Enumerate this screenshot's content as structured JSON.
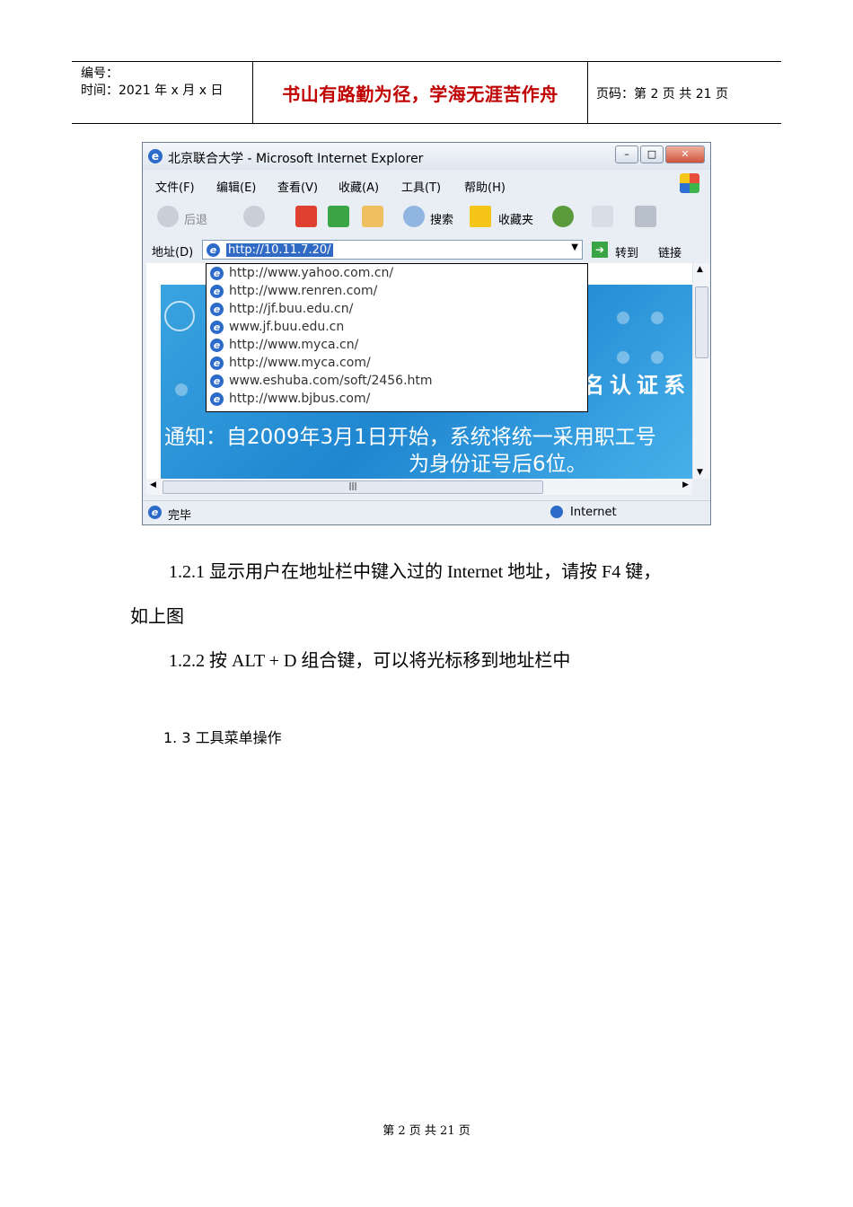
{
  "header": {
    "number_label": "编号：",
    "date_label": "时间：2021 年 x 月 x 日",
    "motto": "书山有路勤为径，学海无涯苦作舟",
    "page_info": "页码：第 2 页  共 21 页"
  },
  "screenshot": {
    "title": "北京联合大学 - Microsoft Internet Explorer",
    "menu": [
      "文件(F)",
      "编辑(E)",
      "查看(V)",
      "收藏(A)",
      "工具(T)",
      "帮助(H)"
    ],
    "toolbar": {
      "back": "后退",
      "search": "搜索",
      "favorites": "收藏夹"
    },
    "address_label": "地址(D)",
    "address_value": "http://10.11.7.20/",
    "go_label": "转到",
    "links_label": "链接",
    "history": [
      "http://www.yahoo.com.cn/",
      "http://www.renren.com/",
      "http://jf.buu.edu.cn/",
      "www.jf.buu.edu.cn",
      "http://www.myca.cn/",
      "http://www.myca.com/",
      "www.eshuba.com/soft/2456.htm",
      "http://www.bjbus.com/"
    ],
    "banner_partial": "名认证系",
    "notice_line1": "通知：自2009年3月1日开始，系统将统一采用职工号",
    "notice_line2": "为身份证号后6位。",
    "status": "完毕",
    "zone": "Internet"
  },
  "body": {
    "p1_line1": "1.2.1 显示用户在地址栏中键入过的  Internet 地址，请按  F4 键，",
    "p1_line2": "如上图",
    "p2": "1.2.2 按  ALT + D 组合键，可以将光标移到地址栏中",
    "section": "1. 3 工具菜单操作"
  },
  "footer": "第 2 页 共 21 页"
}
